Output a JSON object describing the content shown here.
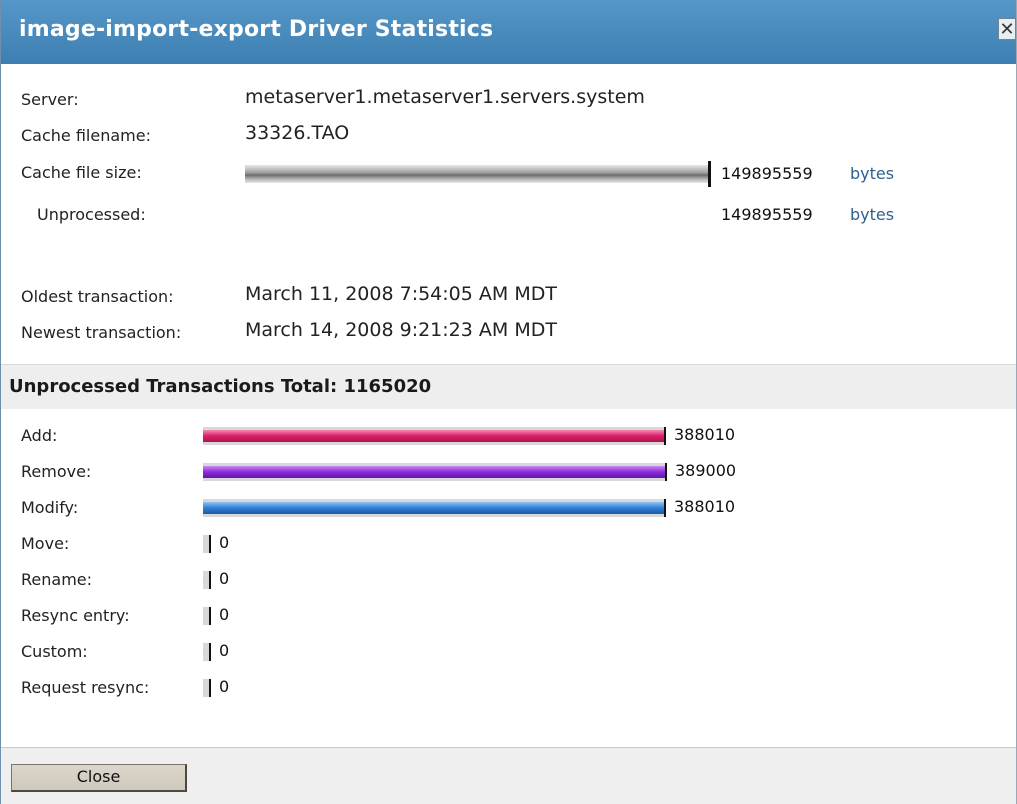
{
  "dialog": {
    "title": "image-import-export Driver Statistics",
    "close_glyph": "✕"
  },
  "info": {
    "server_label": "Server:",
    "server_value": "metaserver1.metaserver1.servers.system",
    "cache_filename_label": "Cache filename:",
    "cache_filename_value": "33326.TAO",
    "cache_size_label": "Cache file size:",
    "cache_size_value": "149895559",
    "cache_size_unit": "bytes",
    "cache_size_fraction": 1.0,
    "unprocessed_label": "Unprocessed:",
    "unprocessed_value": "149895559",
    "unprocessed_unit": "bytes",
    "oldest_label": "Oldest transaction:",
    "oldest_value": "March 11, 2008 7:54:05 AM MDT",
    "newest_label": "Newest transaction:",
    "newest_value": "March 14, 2008 9:21:23 AM MDT"
  },
  "transactions": {
    "section_label": "Unprocessed Transactions Total:",
    "total": "1165020",
    "max": 389000,
    "rows": [
      {
        "label": "Add:",
        "value": 388010,
        "display": "388010",
        "color": "pink"
      },
      {
        "label": "Remove:",
        "value": 389000,
        "display": "389000",
        "color": "purple"
      },
      {
        "label": "Modify:",
        "value": 388010,
        "display": "388010",
        "color": "blue"
      },
      {
        "label": "Move:",
        "value": 0,
        "display": "0",
        "color": "none"
      },
      {
        "label": "Rename:",
        "value": 0,
        "display": "0",
        "color": "none"
      },
      {
        "label": "Resync entry:",
        "value": 0,
        "display": "0",
        "color": "none"
      },
      {
        "label": "Custom:",
        "value": 0,
        "display": "0",
        "color": "none"
      },
      {
        "label": "Request resync:",
        "value": 0,
        "display": "0",
        "color": "none"
      }
    ]
  },
  "footer": {
    "close_label": "Close"
  }
}
